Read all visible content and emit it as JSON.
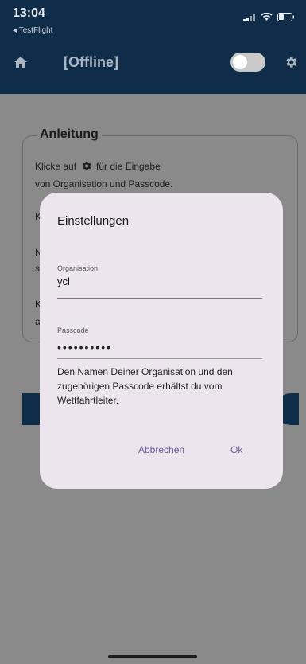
{
  "status": {
    "time": "13:04",
    "back_app": "◂ TestFlight",
    "icons": [
      "signal-icon",
      "wifi-icon",
      "battery-icon"
    ]
  },
  "appbar": {
    "home_icon": "home-icon",
    "title": "[Offline]",
    "toggle_on": false,
    "settings_icon": "gear-icon"
  },
  "background_card": {
    "title": "Anleitung",
    "line1_prefix": "Klicke auf",
    "line1_suffix": "für die Eingabe",
    "line2": "von Organisation und Passcode.",
    "stubs": [
      "K",
      "N",
      "s",
      "K",
      "a"
    ]
  },
  "dialog": {
    "title": "Einstellungen",
    "organisation_label": "Organisation",
    "organisation_value": "ycl",
    "passcode_label": "Passcode",
    "passcode_value": "••••••••••",
    "help_text": "Den Namen Deiner Organisation und den zugehörigen Passcode erhältst du vom Wettfahrtleiter.",
    "cancel_label": "Abbrechen",
    "ok_label": "Ok"
  },
  "colors": {
    "header": "#0f2d48",
    "scrim": "#8a8a8a",
    "dialog": "#ece5ee",
    "accent": "#6a5a96"
  }
}
